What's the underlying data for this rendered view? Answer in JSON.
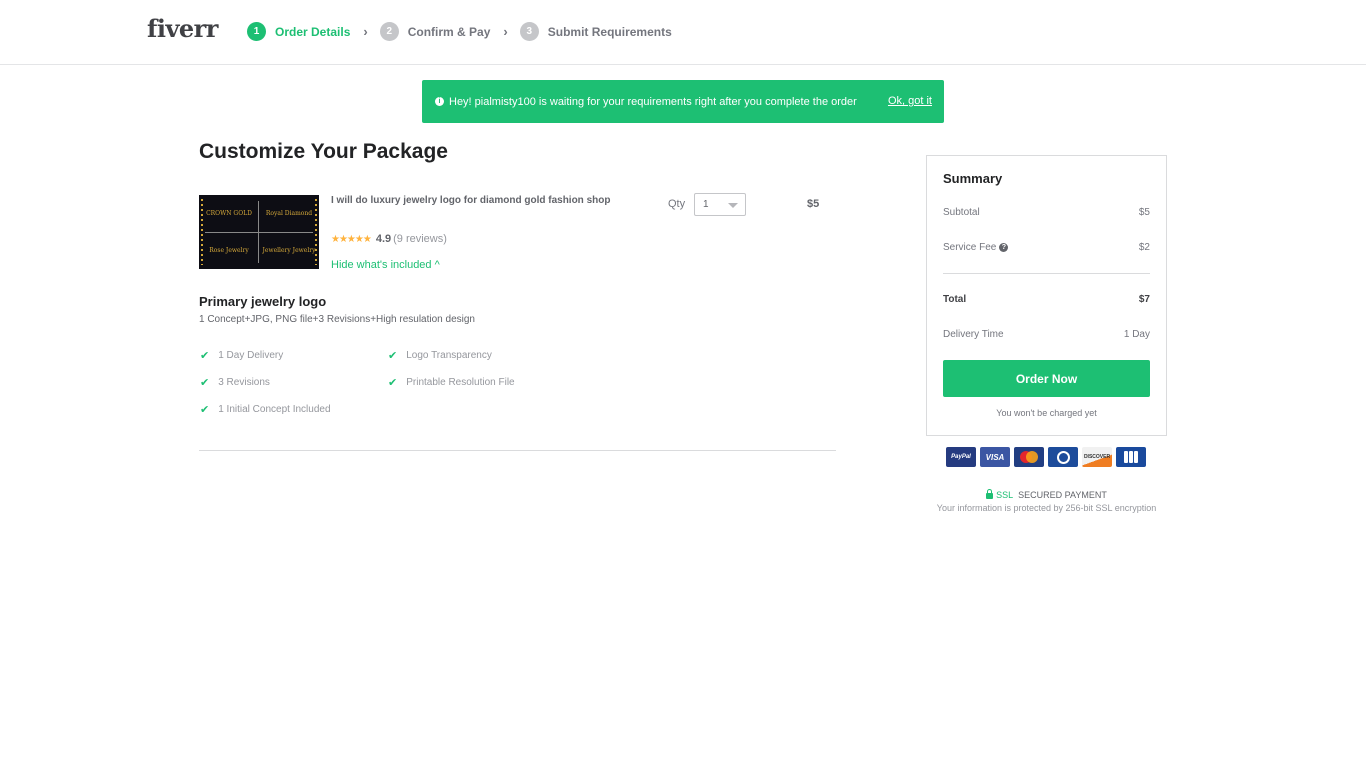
{
  "header": {
    "logo": "fiverr",
    "steps": [
      {
        "num": "1",
        "label": "Order Details",
        "active": true
      },
      {
        "num": "2",
        "label": "Confirm & Pay",
        "active": false
      },
      {
        "num": "3",
        "label": "Submit Requirements",
        "active": false
      }
    ],
    "step_separator_icon": "chevron-right-icon"
  },
  "notice": {
    "icon": "info-icon",
    "icon_glyph": "i",
    "text": "Hey! pialmisty100 is waiting for your requirements right after you complete the order",
    "dismiss_label": "Ok, got it"
  },
  "page_title": "Customize Your Package",
  "gig": {
    "thumbnail_labels": [
      "CROWN GOLD",
      "Royal Diamond",
      "Rose Jewelry",
      "Jewellery Jewelry"
    ],
    "title": "I will do luxury jewelry logo for diamond gold fashion shop",
    "stars": "★★★★★",
    "rating": "4.9",
    "reviews": "(9 reviews)",
    "toggle_label": "Hide what's included ^",
    "qty_label": "Qty",
    "qty_value": "1",
    "price": "$5"
  },
  "package": {
    "name": "Primary jewelry logo",
    "description": "1 Concept+JPG, PNG file+3 Revisions+High resulation design",
    "check_glyph": "✔",
    "features": [
      "1 Day Delivery",
      "Logo Transparency",
      "3 Revisions",
      "Printable Resolution File",
      "1 Initial Concept Included"
    ]
  },
  "summary": {
    "title": "Summary",
    "subtotal_label": "Subtotal",
    "subtotal_value": "$5",
    "fee_label": "Service Fee",
    "fee_help_glyph": "?",
    "fee_value": "$2",
    "total_label": "Total",
    "total_value": "$7",
    "delivery_label": "Delivery Time",
    "delivery_value": "1 Day",
    "order_button": "Order Now",
    "no_charge_note": "You won't be charged yet"
  },
  "payment": {
    "cards": [
      "PayPal",
      "VISA",
      "MasterCard",
      "Diners Club",
      "DISCOVER",
      "JCB"
    ],
    "ssl_label": "SSL",
    "secured_label": "SECURED PAYMENT",
    "ssl_note": "Your information is protected by 256-bit SSL encryption"
  },
  "colors": {
    "brand_green": "#1dbf73",
    "text_dark": "#222325",
    "text_muted": "#74767e",
    "star": "#ffb33e"
  }
}
